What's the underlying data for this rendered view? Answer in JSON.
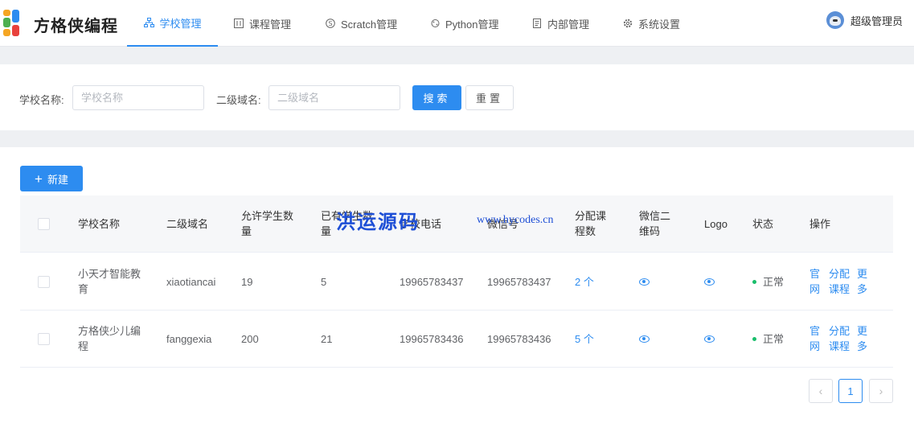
{
  "app": {
    "logo_text": "方格侠编程"
  },
  "nav": [
    {
      "label": "学校管理",
      "icon": "org-chart-icon"
    },
    {
      "label": "课程管理",
      "icon": "grid-icon"
    },
    {
      "label": "Scratch管理",
      "icon": "scratch-icon"
    },
    {
      "label": "Python管理",
      "icon": "python-icon"
    },
    {
      "label": "内部管理",
      "icon": "document-icon"
    },
    {
      "label": "系统设置",
      "icon": "gear-icon"
    }
  ],
  "active_nav": "学校管理",
  "user": {
    "name": "超级管理员"
  },
  "search": {
    "school_label": "学校名称:",
    "school_placeholder": "学校名称",
    "domain_label": "二级域名:",
    "domain_placeholder": "二级域名",
    "search_button": "搜索",
    "reset_button": "重置"
  },
  "toolbar": {
    "new_button": "新建"
  },
  "table": {
    "columns": [
      "学校名称",
      "二级域名",
      "允许学生数量",
      "已有学生数量",
      "学校电话",
      "微信号",
      "分配课程数",
      "微信二维码",
      "Logo",
      "状态",
      "操作"
    ],
    "rows": [
      {
        "name": "小天才智能教育",
        "domain": "xiaotiancai",
        "allowed": "19",
        "existing": "5",
        "phone": "19965783437",
        "wechat": "19965783437",
        "courses": "2 个",
        "status": "正常"
      },
      {
        "name": "方格侠少儿编程",
        "domain": "fanggexia",
        "allowed": "200",
        "existing": "21",
        "phone": "19965783436",
        "wechat": "19965783436",
        "courses": "5 个",
        "status": "正常"
      }
    ],
    "ops": [
      "官网",
      "分配课程",
      "更多"
    ]
  },
  "pagination": {
    "current": "1"
  },
  "watermark": {
    "text": "洪运源码",
    "url": "www.hycodes.cn"
  },
  "colors": {
    "primary": "#2d8cf0",
    "success": "#19be6b",
    "header_bg": "#f6f7f9",
    "page_bg": "#eef0f3"
  }
}
